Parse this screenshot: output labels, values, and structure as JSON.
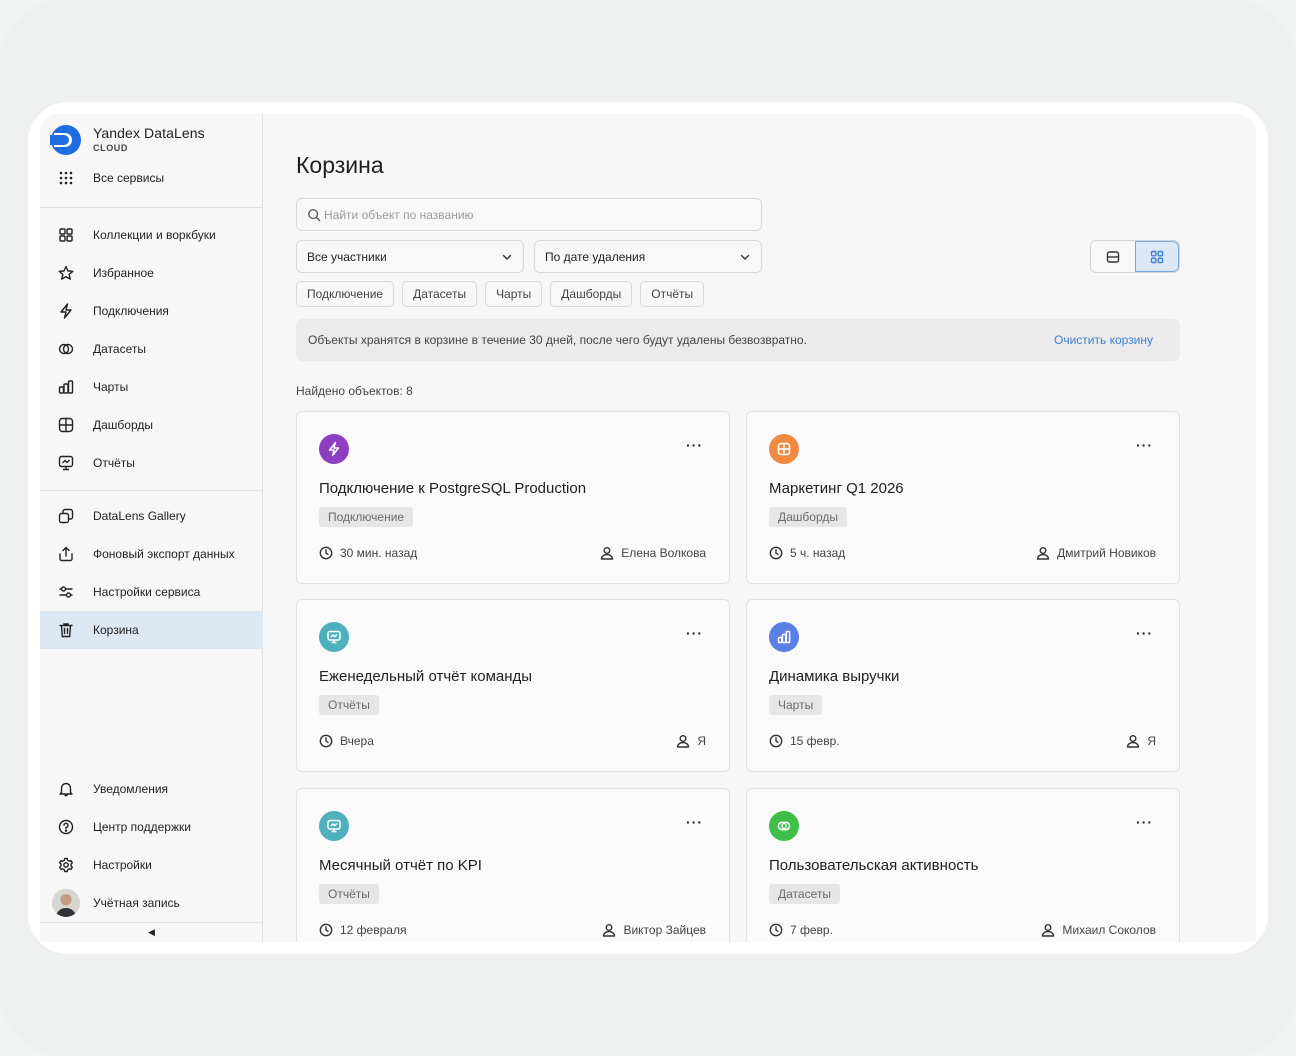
{
  "brand": {
    "title": "Yandex DataLens",
    "subtitle": "CLOUD",
    "all_services": "Все сервисы"
  },
  "sidebar": {
    "items": [
      {
        "label": "Коллекции и воркбуки",
        "icon": "collections-icon"
      },
      {
        "label": "Избранное",
        "icon": "star-icon"
      },
      {
        "label": "Подключения",
        "icon": "bolt-icon"
      },
      {
        "label": "Датасеты",
        "icon": "dataset-icon"
      },
      {
        "label": "Чарты",
        "icon": "chart-icon"
      },
      {
        "label": "Дашборды",
        "icon": "dashboard-icon"
      },
      {
        "label": "Отчёты",
        "icon": "report-icon"
      }
    ],
    "items2": [
      {
        "label": "DataLens Gallery",
        "icon": "gallery-icon"
      },
      {
        "label": "Фоновый экспорт данных",
        "icon": "export-icon"
      },
      {
        "label": "Настройки сервиса",
        "icon": "sliders-icon"
      },
      {
        "label": "Корзина",
        "icon": "trash-icon"
      }
    ],
    "bottom": [
      {
        "label": "Уведомления",
        "icon": "bell-icon"
      },
      {
        "label": "Центр поддержки",
        "icon": "help-icon"
      },
      {
        "label": "Настройки",
        "icon": "gear-icon"
      },
      {
        "label": "Учётная запись",
        "icon": "avatar"
      }
    ],
    "collapse_glyph": "◀"
  },
  "main": {
    "title": "Корзина",
    "search_placeholder": "Найти объект по названию",
    "filter_members": "Все участники",
    "filter_sort": "По дате удаления",
    "chips": [
      "Подключение",
      "Датасеты",
      "Чарты",
      "Дашборды",
      "Отчёты"
    ],
    "banner_text": "Объекты хранятся в корзине в течение 30 дней, после чего будут удалены безвозвратно.",
    "banner_link": "Очистить корзину",
    "found": "Найдено объектов: 8",
    "menu_glyph": "···"
  },
  "cards": [
    {
      "title": "Подключение к PostgreSQL Production",
      "tag": "Подключение",
      "time": "30 мин. назад",
      "user": "Елена Волкова",
      "icon": "bolt-icon",
      "color": "#8e3ec0"
    },
    {
      "title": "Маркетинг Q1 2026",
      "tag": "Дашборды",
      "time": "5 ч. назад",
      "user": "Дмитрий Новиков",
      "icon": "dashboard-icon",
      "color": "#f08a42"
    },
    {
      "title": "Еженедельный отчёт команды",
      "tag": "Отчёты",
      "time": "Вчера",
      "user": "Я",
      "icon": "report-icon",
      "color": "#4fb0bd"
    },
    {
      "title": "Динамика выручки",
      "tag": "Чарты",
      "time": "15 февр.",
      "user": "Я",
      "icon": "chart-icon",
      "color": "#5a7fe6"
    },
    {
      "title": "Месячный отчёт по KPI",
      "tag": "Отчёты",
      "time": "12 февраля",
      "user": "Виктор Зайцев",
      "icon": "report-icon",
      "color": "#4fb0bd"
    },
    {
      "title": "Пользовательская активность",
      "tag": "Датасеты",
      "time": "7 февр.",
      "user": "Михаил Соколов",
      "icon": "dataset-icon",
      "color": "#3fbf4a"
    }
  ]
}
